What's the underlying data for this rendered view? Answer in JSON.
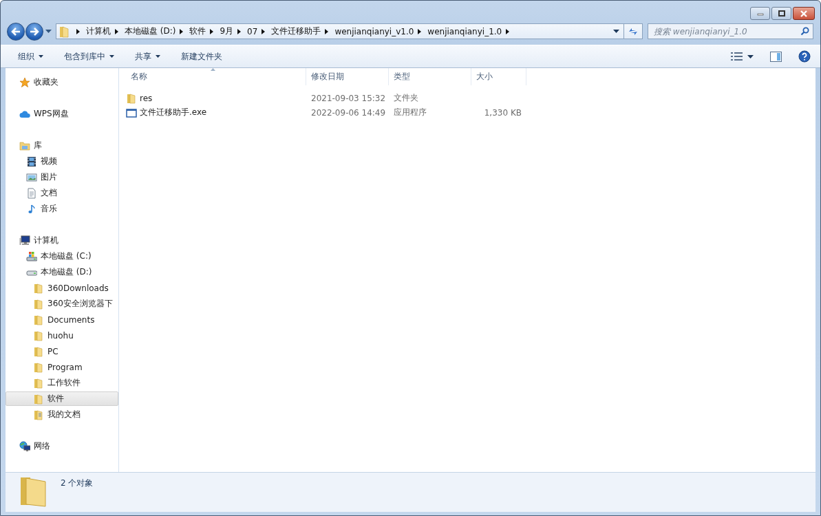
{
  "breadcrumb": [
    "计算机",
    "本地磁盘 (D:)",
    "软件",
    "9月",
    "07",
    "文件迁移助手",
    "wenjianqianyi_v1.0",
    "wenjianqianyi_1.0"
  ],
  "search": {
    "placeholder": "搜索 wenjianqianyi_1.0"
  },
  "toolbar": [
    {
      "label": "组织",
      "dropdown": true
    },
    {
      "label": "包含到库中",
      "dropdown": true
    },
    {
      "label": "共享",
      "dropdown": true
    },
    {
      "label": "新建文件夹",
      "dropdown": false
    }
  ],
  "sidebar": {
    "items": [
      {
        "label": "收藏夹",
        "kind": "star",
        "selected": false
      },
      {
        "label": "WPS网盘",
        "kind": "cloud",
        "selected": false
      },
      {
        "label": "库",
        "kind": "library",
        "selected": false,
        "children": [
          {
            "label": "视频",
            "kind": "video",
            "selected": false
          },
          {
            "label": "图片",
            "kind": "picture",
            "selected": false
          },
          {
            "label": "文档",
            "kind": "document",
            "selected": false
          },
          {
            "label": "音乐",
            "kind": "music",
            "selected": false
          }
        ]
      },
      {
        "label": "计算机",
        "kind": "computer",
        "selected": false,
        "children": [
          {
            "label": "本地磁盘 (C:)",
            "kind": "sysdrive",
            "selected": false
          },
          {
            "label": "本地磁盘 (D:)",
            "kind": "drive",
            "selected": false,
            "children": [
              {
                "label": "360Downloads",
                "kind": "folder",
                "selected": false
              },
              {
                "label": "360安全浏览器下",
                "kind": "folder",
                "selected": false
              },
              {
                "label": "Documents",
                "kind": "folder",
                "selected": false
              },
              {
                "label": "huohu",
                "kind": "folder",
                "selected": false
              },
              {
                "label": "PC",
                "kind": "folder",
                "selected": false
              },
              {
                "label": "Program",
                "kind": "folder",
                "selected": false
              },
              {
                "label": "工作软件",
                "kind": "folder",
                "selected": false
              },
              {
                "label": "软件",
                "kind": "folder",
                "selected": true
              },
              {
                "label": "我的文档",
                "kind": "docfolder",
                "selected": false
              }
            ]
          }
        ]
      },
      {
        "label": "网络",
        "kind": "network",
        "selected": false
      }
    ]
  },
  "table": {
    "columns": [
      {
        "label": "名称",
        "sorted": true
      },
      {
        "label": "修改日期",
        "sorted": false
      },
      {
        "label": "类型",
        "sorted": false
      },
      {
        "label": "大小",
        "sorted": false
      }
    ],
    "rows": [
      {
        "kind": "folder",
        "name": "res",
        "modified": "2021-09-03 15:32",
        "type": "文件夹"
      },
      {
        "kind": "exe",
        "name": "文件迁移助手.exe",
        "modified": "2022-09-06 14:49",
        "type": "应用程序",
        "size": "1,330 KB"
      }
    ]
  },
  "status_bar": {
    "text": "2 个对象"
  }
}
